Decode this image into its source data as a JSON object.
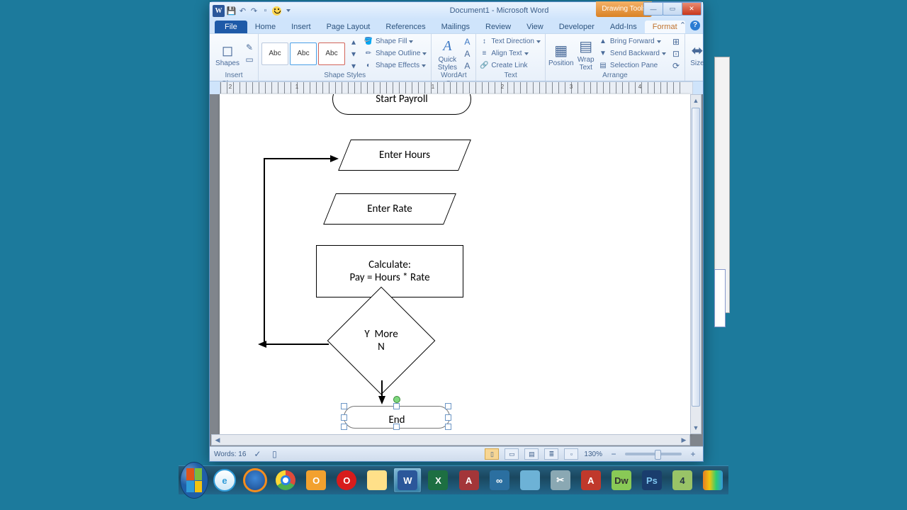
{
  "window": {
    "title": "Document1 - Microsoft Word",
    "contextualTab": "Drawing Tools",
    "app_initial": "W"
  },
  "tabs": {
    "file": "File",
    "list": [
      "Home",
      "Insert",
      "Page Layout",
      "References",
      "Mailings",
      "Review",
      "View",
      "Developer",
      "Add-Ins"
    ],
    "contextual": "Format"
  },
  "ribbon": {
    "insertShapes": {
      "big": "Shapes",
      "label": "Insert Shapes"
    },
    "shapeStyles": {
      "label": "Shape Styles",
      "sample": "Abc",
      "fill": "Shape Fill",
      "outline": "Shape Outline",
      "effects": "Shape Effects"
    },
    "wordart": {
      "big": "Quick Styles",
      "label": "WordArt Sty..."
    },
    "text": {
      "direction": "Text Direction",
      "align": "Align Text",
      "link": "Create Link",
      "label": "Text"
    },
    "arrange": {
      "position": "Position",
      "wrap": "Wrap Text",
      "fwd": "Bring Forward",
      "back": "Send Backward",
      "pane": "Selection Pane",
      "label": "Arrange"
    },
    "size": {
      "big": "Size"
    }
  },
  "ruler": {
    "marks": [
      "2",
      "1",
      "1",
      "2",
      "3",
      "4"
    ]
  },
  "flowchart": {
    "start": "Start Payroll",
    "hours": "Enter Hours",
    "rate": "Enter Rate",
    "calc1": "Calculate:",
    "calc2": "Pay = Hours * Rate",
    "dY": "Y",
    "dMore": "More",
    "dN": "N",
    "end": "End"
  },
  "status": {
    "words": "Words: 16",
    "zoom": "130%"
  },
  "taskbar": {
    "items": [
      {
        "name": "ie",
        "txt": "e"
      },
      {
        "name": "firefox",
        "txt": ""
      },
      {
        "name": "chrome",
        "txt": ""
      },
      {
        "name": "outlook",
        "txt": "O"
      },
      {
        "name": "opera",
        "txt": "O"
      },
      {
        "name": "explorer",
        "txt": ""
      },
      {
        "name": "word",
        "txt": "W"
      },
      {
        "name": "excel",
        "txt": "X"
      },
      {
        "name": "access",
        "txt": "A"
      },
      {
        "name": "app",
        "txt": "∞"
      },
      {
        "name": "notepad",
        "txt": ""
      },
      {
        "name": "snip",
        "txt": "✂"
      },
      {
        "name": "reader",
        "txt": "A"
      },
      {
        "name": "dreamweaver",
        "txt": "Dw"
      },
      {
        "name": "photoshop",
        "txt": "Ps"
      },
      {
        "name": "notepad4",
        "txt": "4"
      },
      {
        "name": "movie",
        "txt": ""
      }
    ]
  }
}
